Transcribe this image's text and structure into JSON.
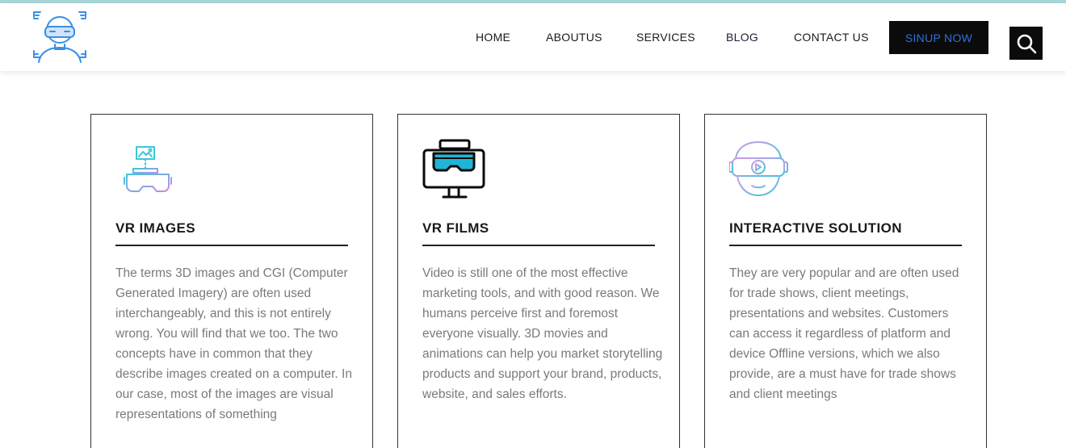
{
  "nav": {
    "items": [
      {
        "label": "HOME"
      },
      {
        "label": "ABOUTUS"
      },
      {
        "label": "SERVICES"
      },
      {
        "label": "BLOG"
      },
      {
        "label": "CONTACT US"
      }
    ],
    "signup_label": "SINUP NOW",
    "search_icon": "search-icon",
    "logo_icon": "vr-headset-person-icon"
  },
  "colors": {
    "signup_text": "#2f6fde",
    "button_bg": "#0b0b0b",
    "card_border": "#333333",
    "body_text": "#7a7a7a",
    "top_strip": "#a9d6d6"
  },
  "cards": [
    {
      "icon": "vr-image-icon",
      "title": "VR IMAGES",
      "text": "The terms 3D images and CGI (Computer Generated Imagery) are often used interchangeably, and this is not entirely wrong. You will find that we too. The two concepts have in common that they describe images created on a computer. In our case, most of the images are visual representations of something"
    },
    {
      "icon": "vr-monitor-icon",
      "title": "VR FILMS",
      "text": "Video is still one of the most effective marketing tools, and with good reason. We humans perceive first and foremost everyone visually. 3D movies and animations can help you market storytelling products and support your brand, products, website, and sales efforts."
    },
    {
      "icon": "vr-player-head-icon",
      "title": "INTERACTIVE SOLUTION",
      "text": "They are very popular and are often used for trade shows, client meetings, presentations and websites. Customers can access it regardless of platform and device Offline versions, which we also provide, are a must have for trade shows and client meetings"
    }
  ]
}
